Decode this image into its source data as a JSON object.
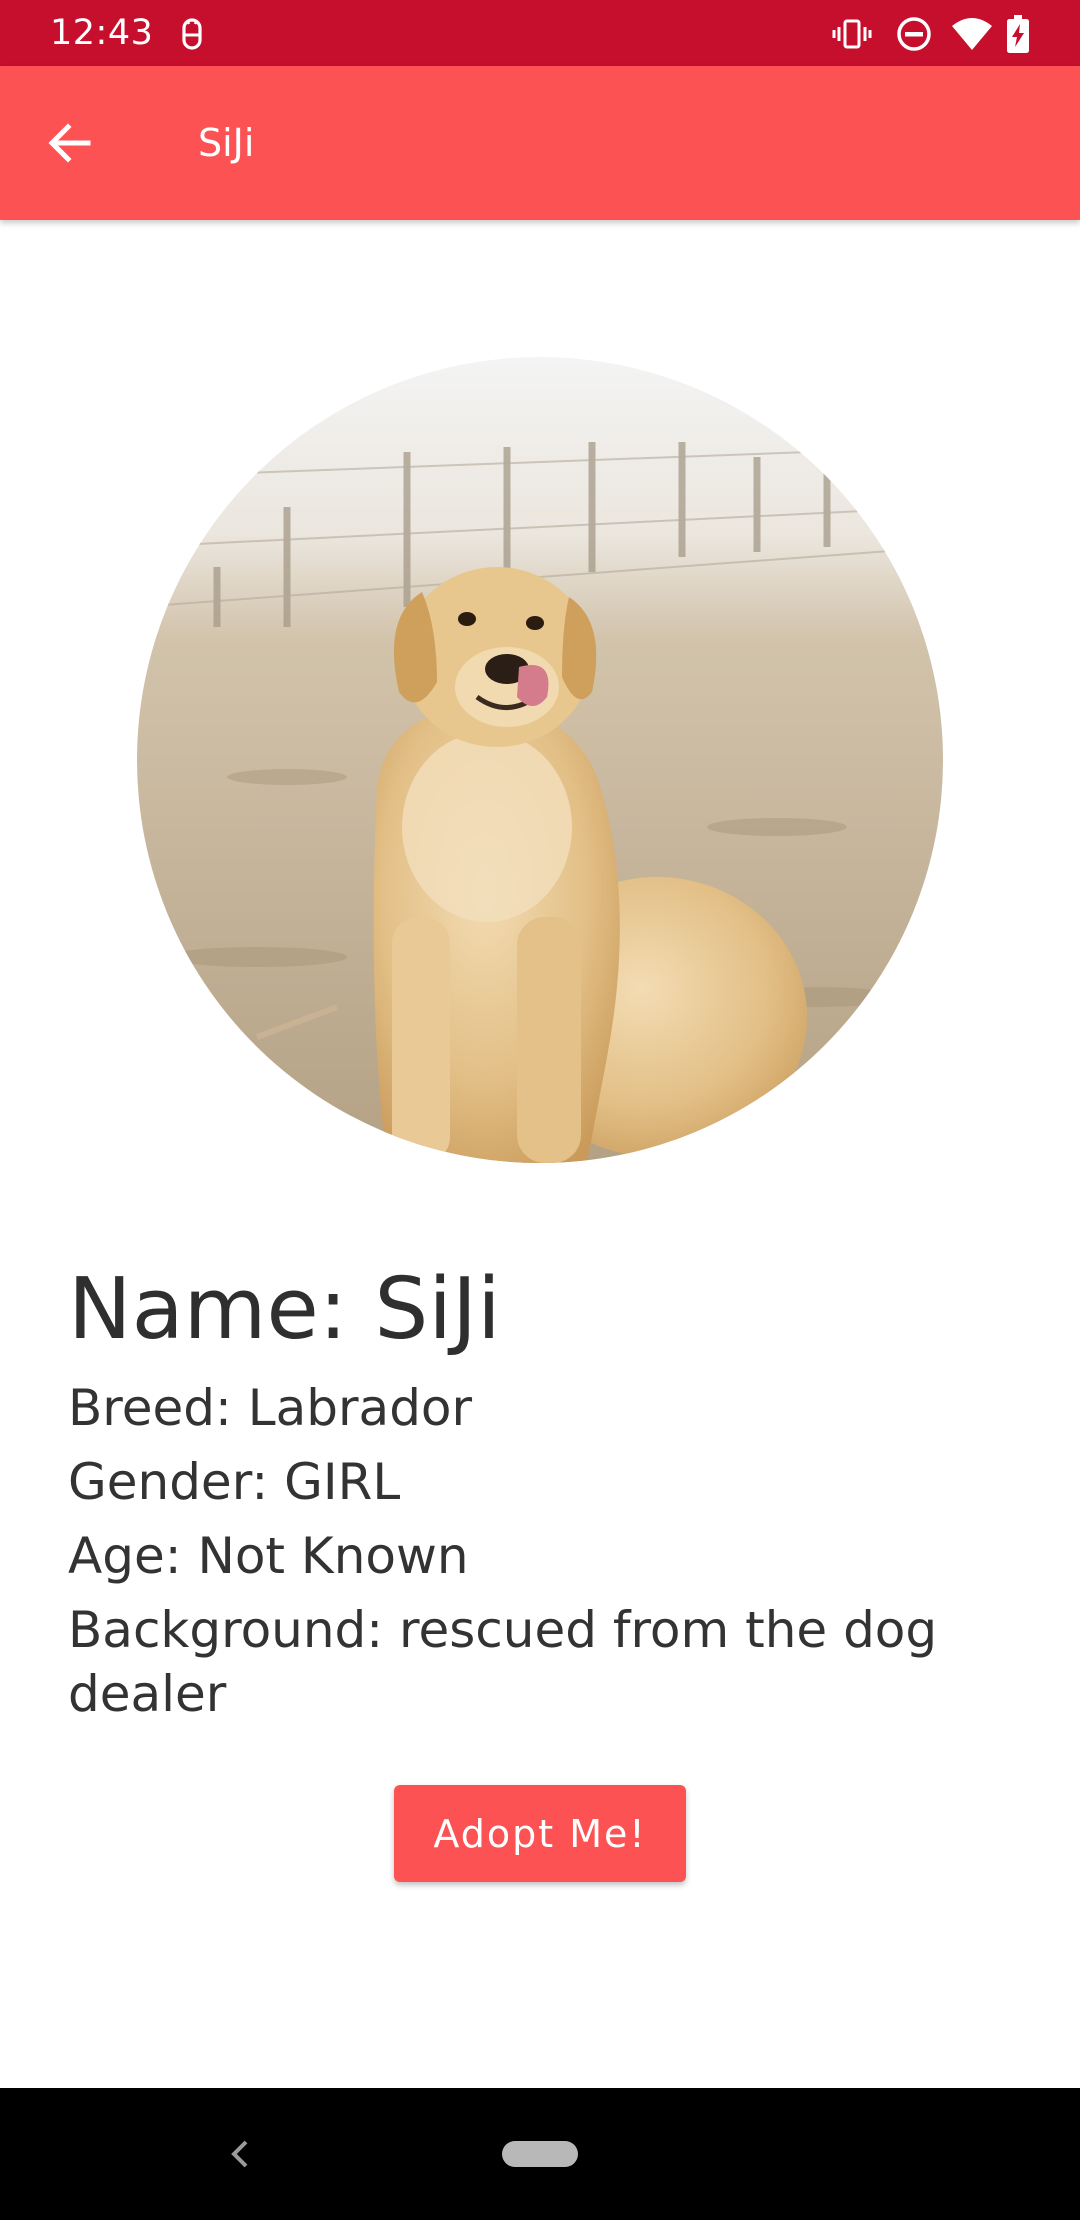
{
  "status_bar": {
    "time": "12:43",
    "icons": [
      "android-notification-icon",
      "vibrate-icon",
      "do-not-disturb-icon",
      "wifi-icon",
      "battery-charging-icon"
    ],
    "background_color": "#c50f2d"
  },
  "app_bar": {
    "title": "SiJi",
    "back_icon": "arrow-back-icon",
    "background_color": "#fc5254"
  },
  "dog": {
    "photo": "labrador-dog-photo",
    "name_line": "Name: SiJi",
    "breed_line": "Breed: Labrador",
    "gender_line": "Gender: GIRL",
    "age_line": "Age: Not Known",
    "background_line": "Background: rescued from the dog dealer"
  },
  "actions": {
    "adopt_label": "Adopt Me!",
    "accent_color": "#fc5254"
  },
  "nav_bar": {
    "back_icon": "nav-back-icon",
    "home_icon": "home-pill-icon"
  }
}
